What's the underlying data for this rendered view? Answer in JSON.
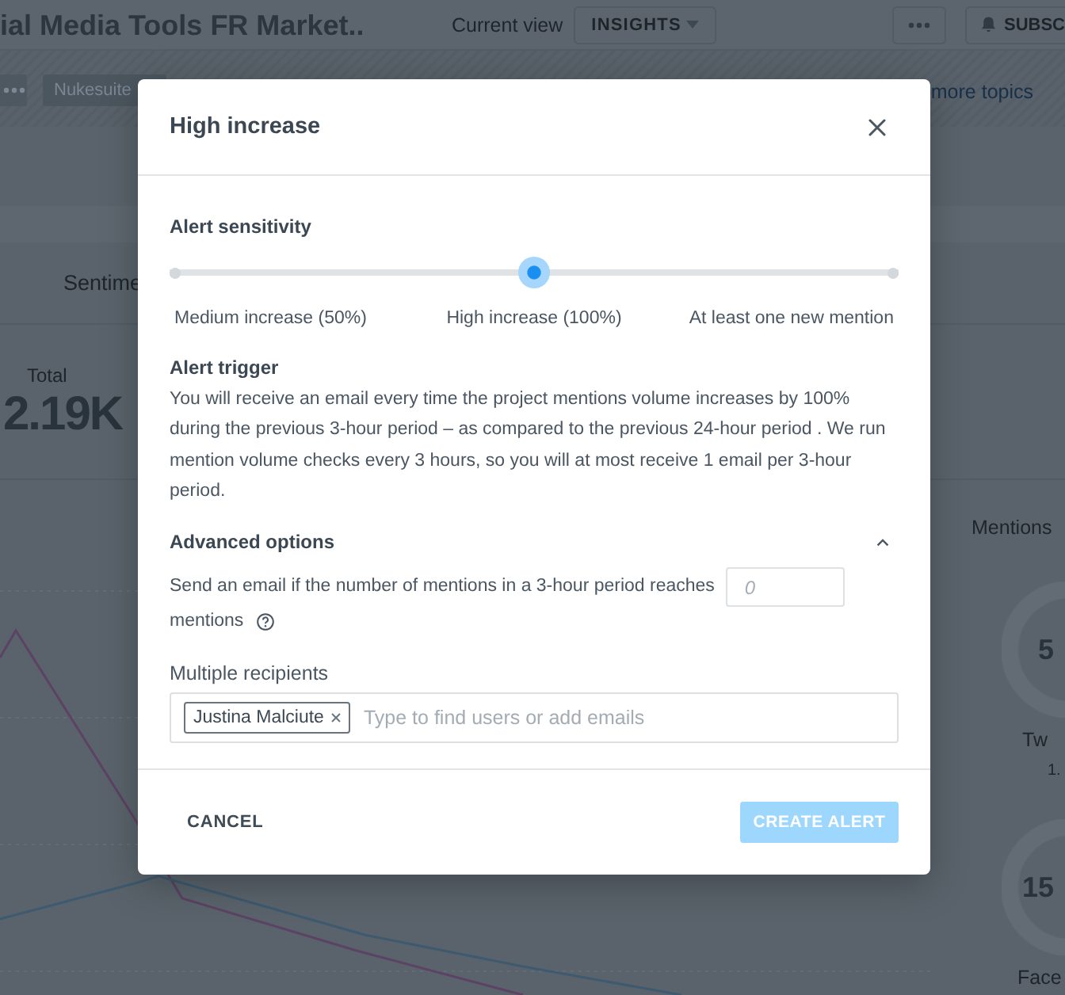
{
  "background": {
    "header": {
      "title": "ial Media Tools FR Market..",
      "view_label": "Current view",
      "view_value": "INSIGHTS",
      "subscribe": "SUBSC"
    },
    "topics": {
      "tags": [
        "Nukesuite"
      ],
      "more_link": "more topics"
    },
    "tabs": [
      {
        "label": "Sentime"
      }
    ],
    "stats": [
      {
        "label": "Total",
        "value": "2.19K"
      }
    ],
    "mentions_panel": {
      "title": "Mentions",
      "sources": [
        {
          "value": "5",
          "name": "Tw",
          "detail": "1."
        },
        {
          "value": "15",
          "name": "Face"
        }
      ]
    }
  },
  "dialog": {
    "title": "High increase",
    "sensitivity": {
      "heading": "Alert sensitivity",
      "level": 0.5,
      "stops": [
        "Medium increase (50%)",
        "High increase (100%)",
        "At least one new mention"
      ]
    },
    "trigger": {
      "heading": "Alert trigger",
      "text": "You will receive an email every time the project mentions volume increases by 100% during the previous 3-hour period – as compared to the previous 24-hour period . We run mention volume checks every 3 hours, so you will at most receive 1 email per 3-hour period."
    },
    "advanced": {
      "heading": "Advanced options",
      "expanded": true,
      "threshold_text": "Send an email if the number of mentions in a 3-hour period reaches",
      "threshold_placeholder": "0",
      "unit": "mentions"
    },
    "recipients": {
      "heading": "Multiple recipients",
      "chips": [
        "Justina Malciute"
      ],
      "placeholder": "Type to find users or add emails"
    },
    "actions": {
      "cancel": "CANCEL",
      "create": {
        "label": "CREATE ALERT",
        "disabled": true
      }
    }
  }
}
